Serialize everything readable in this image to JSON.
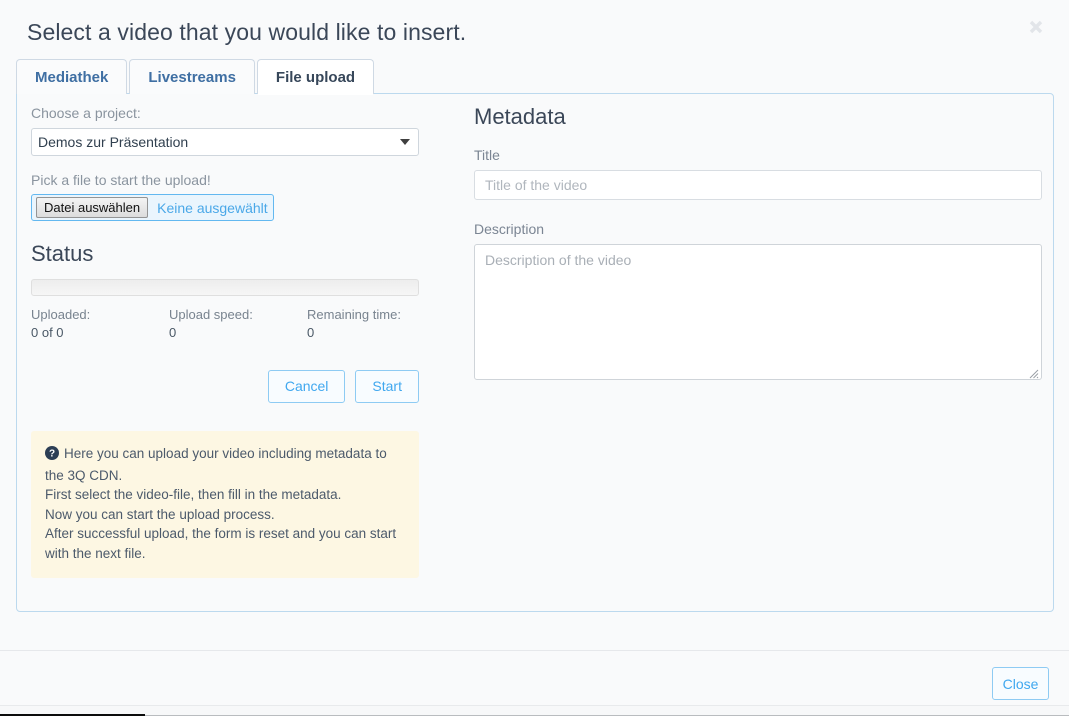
{
  "header": {
    "title": "Select a video that you would like to insert.",
    "close_icon": "close-icon"
  },
  "tabs": [
    {
      "label": "Mediathek",
      "active": false
    },
    {
      "label": "Livestreams",
      "active": false
    },
    {
      "label": "File upload",
      "active": true
    }
  ],
  "upload": {
    "project_label": "Choose a project:",
    "project_selected": "Demos zur Präsentation",
    "pick_file_label": "Pick a file to start the upload!",
    "file_button_label": "Datei auswählen",
    "file_name": "Keine ausgewählt",
    "status_heading": "Status",
    "progress_percent": 0,
    "status": [
      {
        "key": "Uploaded:",
        "value": "0 of 0"
      },
      {
        "key": "Upload speed:",
        "value": "0"
      },
      {
        "key": "Remaining time:",
        "value": "0"
      }
    ],
    "cancel_label": "Cancel",
    "start_label": "Start",
    "info_icon": "question-circle-icon",
    "info_lines": [
      "Here you can upload your video including metadata to the 3Q CDN.",
      "First select the video-file, then fill in the metadata.",
      "Now you can start the upload process.",
      "After successful upload, the form is reset and you can start with the next file."
    ]
  },
  "metadata": {
    "heading": "Metadata",
    "title_label": "Title",
    "title_value": "",
    "title_placeholder": "Title of the video",
    "description_label": "Description",
    "description_value": "",
    "description_placeholder": "Description of the video"
  },
  "footer": {
    "close_label": "Close"
  },
  "colors": {
    "accent": "#41a8ef",
    "panel_border": "#bcd9ee",
    "heading_text": "#3b4758",
    "info_bg": "#fdf7e3",
    "tab_text": "#3f6fa3"
  }
}
